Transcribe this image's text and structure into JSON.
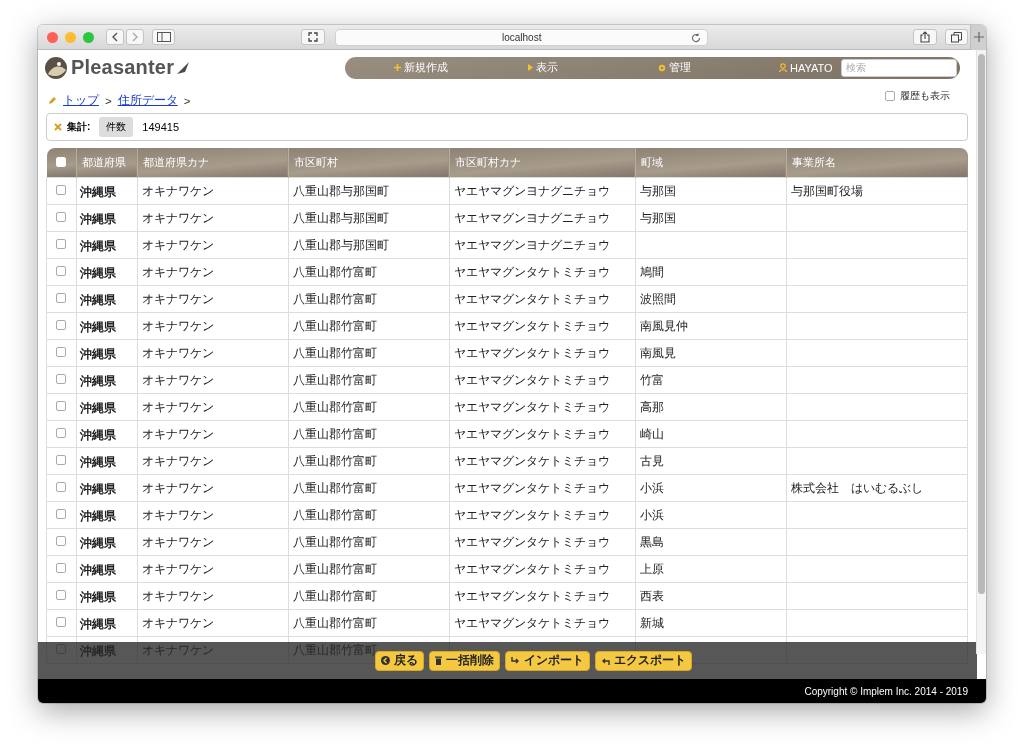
{
  "browser": {
    "address": "localhost"
  },
  "app": {
    "logo": "Pleasanter",
    "nav": [
      {
        "kind": "plus",
        "label": "新規作成"
      },
      {
        "kind": "triangle",
        "label": "表示"
      },
      {
        "kind": "gear",
        "label": "管理"
      },
      {
        "kind": "user",
        "label": "HAYATO"
      }
    ],
    "search": {
      "placeholder": "検索"
    }
  },
  "breadcrumb": {
    "items": [
      "トップ",
      "住所データ"
    ],
    "separator": ">"
  },
  "history": {
    "label": "履歴も表示",
    "checked": false
  },
  "summary": {
    "label": "集計:",
    "chip": "件数",
    "value": "149415"
  },
  "table": {
    "select_all_checked": false,
    "columns": [
      "都道府県",
      "都道府県カナ",
      "市区町村",
      "市区町村カナ",
      "町域",
      "事業所名"
    ],
    "rows": [
      {
        "checked": false,
        "cells": [
          "沖縄県",
          "オキナワケン",
          "八重山郡与那国町",
          "ヤエヤマグンヨナグニチョウ",
          "与那国",
          "与那国町役場"
        ]
      },
      {
        "checked": false,
        "cells": [
          "沖縄県",
          "オキナワケン",
          "八重山郡与那国町",
          "ヤエヤマグンヨナグニチョウ",
          "与那国",
          null
        ]
      },
      {
        "checked": false,
        "cells": [
          "沖縄県",
          "オキナワケン",
          "八重山郡与那国町",
          "ヤエヤマグンヨナグニチョウ",
          null,
          null
        ]
      },
      {
        "checked": false,
        "cells": [
          "沖縄県",
          "オキナワケン",
          "八重山郡竹富町",
          "ヤエヤマグンタケトミチョウ",
          "鳩間",
          null
        ]
      },
      {
        "checked": false,
        "cells": [
          "沖縄県",
          "オキナワケン",
          "八重山郡竹富町",
          "ヤエヤマグンタケトミチョウ",
          "波照間",
          null
        ]
      },
      {
        "checked": false,
        "cells": [
          "沖縄県",
          "オキナワケン",
          "八重山郡竹富町",
          "ヤエヤマグンタケトミチョウ",
          "南風見仲",
          null
        ]
      },
      {
        "checked": false,
        "cells": [
          "沖縄県",
          "オキナワケン",
          "八重山郡竹富町",
          "ヤエヤマグンタケトミチョウ",
          "南風見",
          null
        ]
      },
      {
        "checked": false,
        "cells": [
          "沖縄県",
          "オキナワケン",
          "八重山郡竹富町",
          "ヤエヤマグンタケトミチョウ",
          "竹富",
          null
        ]
      },
      {
        "checked": false,
        "cells": [
          "沖縄県",
          "オキナワケン",
          "八重山郡竹富町",
          "ヤエヤマグンタケトミチョウ",
          "高那",
          null
        ]
      },
      {
        "checked": false,
        "cells": [
          "沖縄県",
          "オキナワケン",
          "八重山郡竹富町",
          "ヤエヤマグンタケトミチョウ",
          "崎山",
          null
        ]
      },
      {
        "checked": false,
        "cells": [
          "沖縄県",
          "オキナワケン",
          "八重山郡竹富町",
          "ヤエヤマグンタケトミチョウ",
          "古見",
          null
        ]
      },
      {
        "checked": false,
        "cells": [
          "沖縄県",
          "オキナワケン",
          "八重山郡竹富町",
          "ヤエヤマグンタケトミチョウ",
          "小浜",
          "株式会社　はいむるぶし"
        ]
      },
      {
        "checked": false,
        "cells": [
          "沖縄県",
          "オキナワケン",
          "八重山郡竹富町",
          "ヤエヤマグンタケトミチョウ",
          "小浜",
          null
        ]
      },
      {
        "checked": false,
        "cells": [
          "沖縄県",
          "オキナワケン",
          "八重山郡竹富町",
          "ヤエヤマグンタケトミチョウ",
          "黒島",
          null
        ]
      },
      {
        "checked": false,
        "cells": [
          "沖縄県",
          "オキナワケン",
          "八重山郡竹富町",
          "ヤエヤマグンタケトミチョウ",
          "上原",
          null
        ]
      },
      {
        "checked": false,
        "cells": [
          "沖縄県",
          "オキナワケン",
          "八重山郡竹富町",
          "ヤエヤマグンタケトミチョウ",
          "西表",
          null
        ]
      },
      {
        "checked": false,
        "cells": [
          "沖縄県",
          "オキナワケン",
          "八重山郡竹富町",
          "ヤエヤマグンタケトミチョウ",
          "新城",
          null
        ]
      },
      {
        "checked": false,
        "cells": [
          "沖縄県",
          "オキナワケン",
          "八重山郡竹富町",
          null,
          null,
          null
        ]
      }
    ]
  },
  "actions": [
    {
      "kind": "back",
      "label": "戻る"
    },
    {
      "kind": "trash",
      "label": "一括削除"
    },
    {
      "kind": "import",
      "label": "インポート"
    },
    {
      "kind": "export",
      "label": "エクスポート"
    }
  ],
  "footer": "Copyright © Implem Inc. 2014 - 2019"
}
